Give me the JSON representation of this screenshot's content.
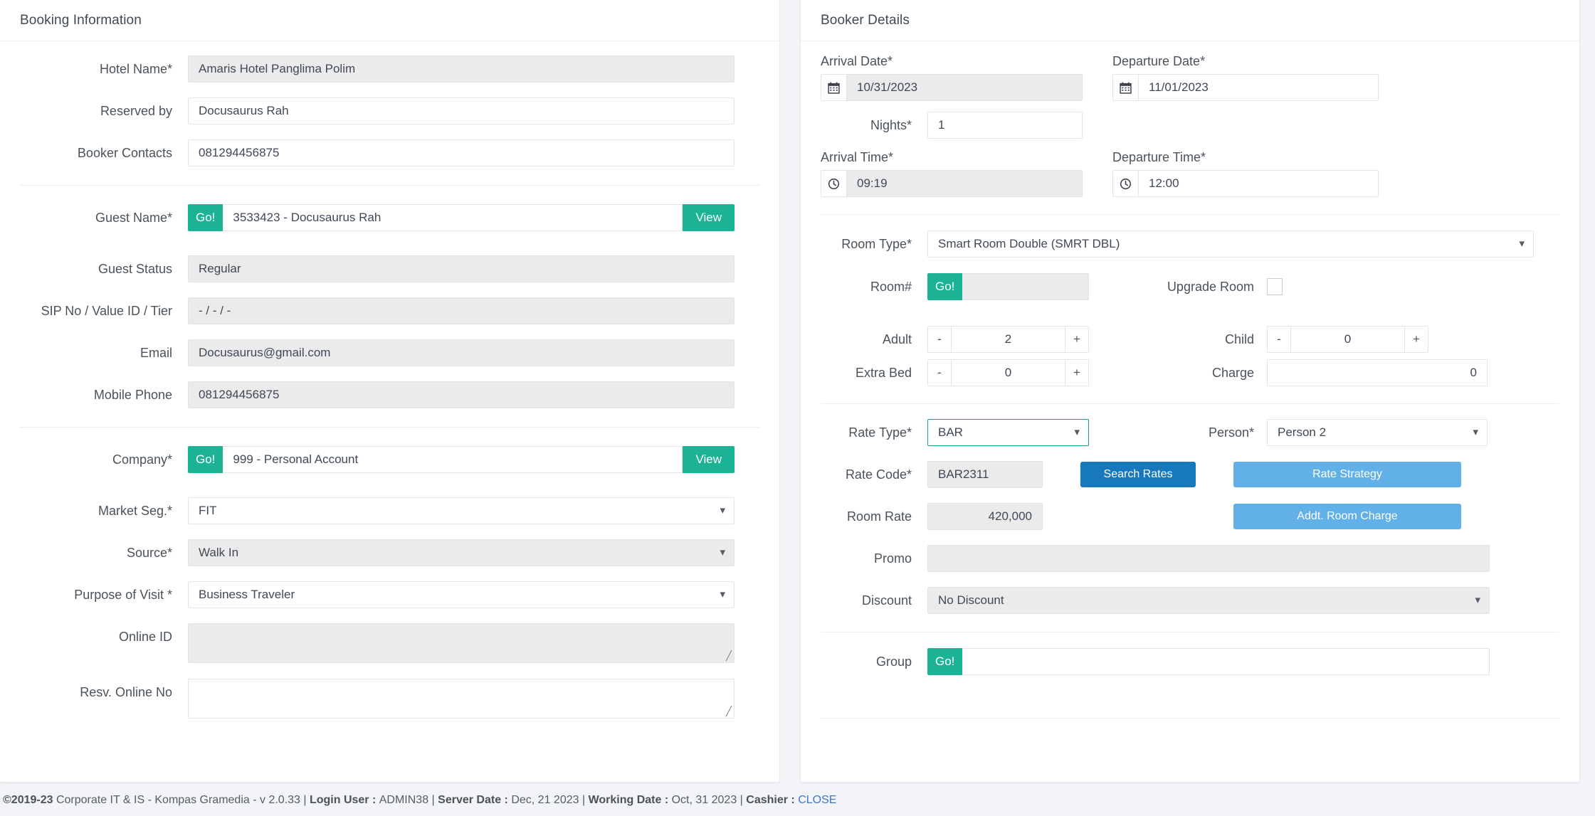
{
  "left_panel": {
    "title": "Booking Information",
    "hotel_name": {
      "label": "Hotel Name*",
      "value": "Amaris Hotel Panglima Polim"
    },
    "reserved_by": {
      "label": "Reserved by",
      "value": "Docusaurus Rah"
    },
    "booker_contacts": {
      "label": "Booker Contacts",
      "value": "081294456875"
    },
    "guest_name": {
      "label": "Guest Name*",
      "value": "3533423 - Docusaurus Rah",
      "go": "Go!",
      "view": "View"
    },
    "guest_status": {
      "label": "Guest Status",
      "value": "Regular"
    },
    "sip_no": {
      "label": "SIP No / Value ID / Tier",
      "value": "-  /  -  /  -"
    },
    "email": {
      "label": "Email",
      "value": "Docusaurus@gmail.com"
    },
    "mobile_phone": {
      "label": "Mobile Phone",
      "value": "081294456875"
    },
    "company": {
      "label": "Company*",
      "value": "999 - Personal Account",
      "go": "Go!",
      "view": "View"
    },
    "market_seg": {
      "label": "Market Seg.*",
      "value": "FIT"
    },
    "source": {
      "label": "Source*",
      "value": "Walk In"
    },
    "purpose_of_visit": {
      "label": "Purpose of Visit *",
      "value": "Business Traveler"
    },
    "online_id": {
      "label": "Online ID",
      "value": ""
    },
    "resv_online_no": {
      "label": "Resv. Online No",
      "value": ""
    }
  },
  "right_panel": {
    "title": "Booker Details",
    "arrival_date": {
      "label": "Arrival Date*",
      "value": "10/31/2023",
      "icon": "calendar-icon"
    },
    "departure_date": {
      "label": "Departure Date*",
      "value": "11/01/2023",
      "icon": "calendar-icon"
    },
    "nights": {
      "label": "Nights*",
      "value": "1"
    },
    "arrival_time": {
      "label": "Arrival Time*",
      "value": "09:19",
      "icon": "clock-icon"
    },
    "departure_time": {
      "label": "Departure Time*",
      "value": "12:00",
      "icon": "clock-icon"
    },
    "room_type": {
      "label": "Room Type*",
      "value": "Smart Room Double (SMRT DBL)"
    },
    "room_no": {
      "label": "Room#",
      "value": "",
      "go": "Go!"
    },
    "upgrade_room": {
      "label": "Upgrade Room",
      "checked": false
    },
    "adult": {
      "label": "Adult",
      "value": "2",
      "minus": "-",
      "plus": "+"
    },
    "child": {
      "label": "Child",
      "value": "0",
      "minus": "-",
      "plus": "+"
    },
    "extra_bed": {
      "label": "Extra Bed",
      "value": "0",
      "minus": "-",
      "plus": "+"
    },
    "charge": {
      "label": "Charge",
      "value": "0"
    },
    "rate_type": {
      "label": "Rate Type*",
      "value": "BAR"
    },
    "person": {
      "label": "Person*",
      "value": "Person 2"
    },
    "rate_code": {
      "label": "Rate Code*",
      "value": "BAR2311"
    },
    "room_rate": {
      "label": "Room Rate",
      "value": "420,000"
    },
    "promo": {
      "label": "Promo",
      "value": ""
    },
    "discount": {
      "label": "Discount",
      "value": "No Discount"
    },
    "group": {
      "label": "Group",
      "value": "",
      "go": "Go!"
    },
    "search_rates_button": "Search Rates",
    "rate_strategy_button": "Rate Strategy",
    "addt_room_charge_button": "Addt. Room Charge"
  },
  "footer": {
    "copyright": "©2019-23",
    "company": " Corporate IT & IS - Kompas Gramedia - v 2.0.33 | ",
    "login_user_label": "Login User : ",
    "login_user_value": "ADMIN38 | ",
    "server_date_label": "Server Date : ",
    "server_date_value": "Dec, 21 2023 | ",
    "working_date_label": "Working Date : ",
    "working_date_value": "Oct, 31 2023 | ",
    "cashier_label": "Cashier : ",
    "cashier_value": "CLOSE"
  },
  "colors": {
    "green": "#1bb394",
    "primary_blue": "#1878bd",
    "info_blue": "#62b0e8",
    "focus_teal": "#18a589",
    "readonly_bg": "#ebebeb"
  }
}
